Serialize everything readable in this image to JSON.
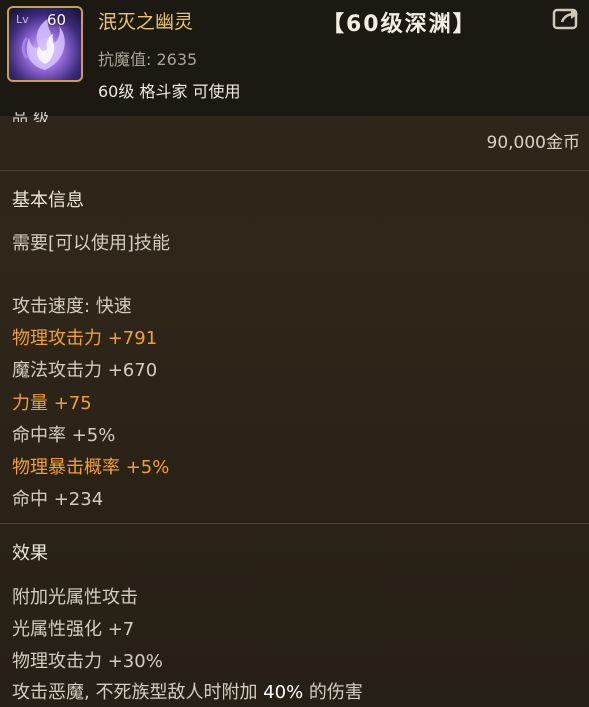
{
  "item": {
    "icon_name": "ghost-flame-icon",
    "icon_level": "60",
    "name": "泯灭之幽灵",
    "stat": "抗魔值: 2635",
    "requirement": "60级 格斗家 可使用",
    "grade_tag": "【60级深渊】",
    "price": "90,000金币"
  },
  "basic_info": {
    "title": "基本信息",
    "skill_req": "需要[可以使用]技能",
    "attack_speed": "攻击速度: 快速",
    "stats": [
      {
        "text": "物理攻击力 +791",
        "highlight": true
      },
      {
        "text": "魔法攻击力 +670",
        "highlight": false
      },
      {
        "text": "力量 +75",
        "highlight": true
      },
      {
        "text": "命中率 +5%",
        "highlight": false
      },
      {
        "text": "物理暴击概率 +5%",
        "highlight": true
      },
      {
        "text": "命中 +234",
        "highlight": false
      }
    ]
  },
  "effects": {
    "title": "效果",
    "lines": [
      "附加光属性攻击",
      "光属性强化 +7",
      "物理攻击力 +30%"
    ],
    "last_line_prefix": "攻击恶魔, 不死族型敌人时附加 ",
    "last_line_value": "40%",
    "last_line_suffix": " 的伤害"
  },
  "colors": {
    "name": "#e8c760",
    "highlight_stat": "#f2a02e",
    "icon_border": "#c7a14a"
  }
}
